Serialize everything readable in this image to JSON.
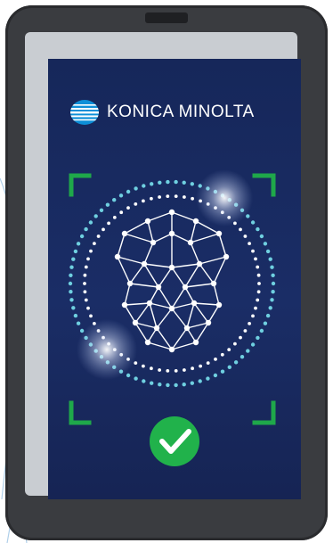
{
  "brand": {
    "name": "KONICA MINOLTA",
    "logo_icon": "konica-minolta-globe-icon"
  },
  "status": {
    "verification_icon": "check-circle-icon",
    "verified": true
  },
  "colors": {
    "screen_bg": "#1a2d66",
    "frame_corner": "#1fa84a",
    "dots": "#6fd0e0",
    "check_bg": "#21b24b",
    "phone_body": "#3a3c40"
  }
}
